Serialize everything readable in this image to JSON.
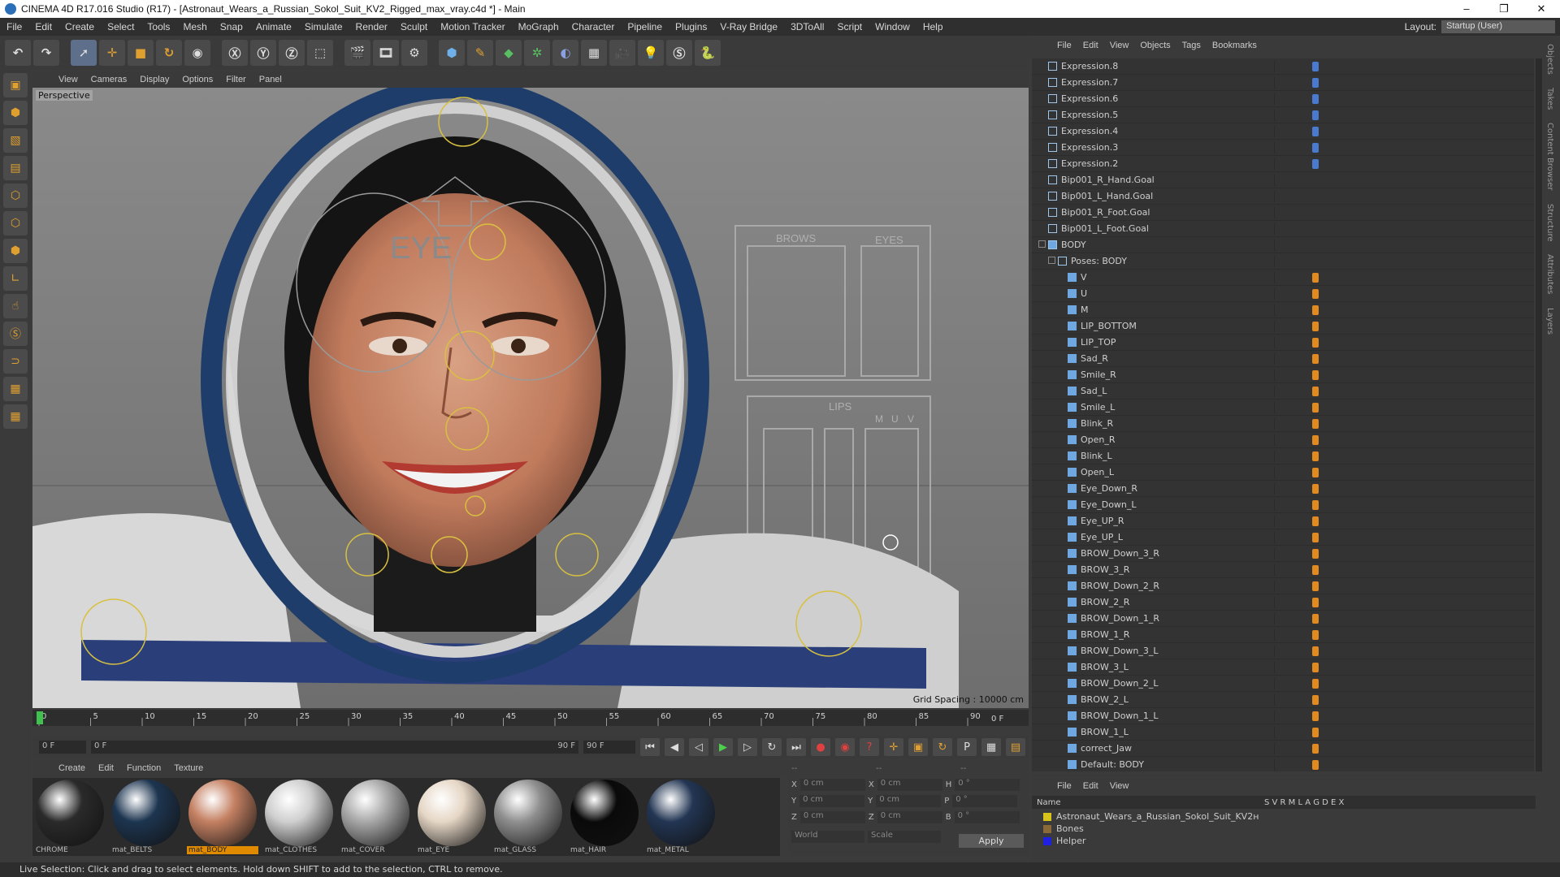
{
  "window": {
    "title": "CINEMA 4D R17.016 Studio (R17) - [Astronaut_Wears_a_Russian_Sokol_Suit_KV2_Rigged_max_vray.c4d *] - Main",
    "controls": [
      "–",
      "❐",
      "✕"
    ]
  },
  "menu": {
    "items": [
      "File",
      "Edit",
      "Create",
      "Select",
      "Tools",
      "Mesh",
      "Snap",
      "Animate",
      "Simulate",
      "Render",
      "Sculpt",
      "Motion Tracker",
      "MoGraph",
      "Character",
      "Pipeline",
      "Plugins",
      "V-Ray Bridge",
      "3DToAll",
      "Script",
      "Window",
      "Help"
    ],
    "layout_label": "Layout:",
    "layout_value": "Startup (User)"
  },
  "viewport": {
    "menu": [
      "View",
      "Cameras",
      "Display",
      "Options",
      "Filter",
      "Panel"
    ],
    "label": "Perspective",
    "grid_spacing": "Grid Spacing : 10000 cm",
    "board": {
      "brows": "BROWS",
      "eyes": "EYES",
      "lips": "LIPS",
      "m": "M",
      "u": "U",
      "v": "V",
      "eye": "EYE"
    }
  },
  "timeline": {
    "ticks": [
      "0",
      "5",
      "10",
      "15",
      "20",
      "25",
      "30",
      "35",
      "40",
      "45",
      "50",
      "55",
      "60",
      "65",
      "70",
      "75",
      "80",
      "85",
      "90"
    ],
    "frame_end": "0 F",
    "start": "0 F",
    "range_start": "0 F",
    "range_end": "90 F",
    "end": "90 F"
  },
  "materials": {
    "menu": [
      "Create",
      "Edit",
      "Function",
      "Texture"
    ],
    "items": [
      {
        "name": "CHROME",
        "color": "#2a2a2a"
      },
      {
        "name": "mat_BELTS",
        "color": "#1d3550"
      },
      {
        "name": "mat_BODY",
        "color": "#c48062"
      },
      {
        "name": "mat_CLOTHES",
        "color": "#cfcfcf"
      },
      {
        "name": "mat_COVER",
        "color": "#a8a8a8"
      },
      {
        "name": "mat_EYE",
        "color": "#e6d7c6"
      },
      {
        "name": "mat_GLASS",
        "color": "#8f8f8f"
      },
      {
        "name": "mat_HAIR",
        "color": "#0a0a0a"
      },
      {
        "name": "mat_METAL",
        "color": "#223553"
      }
    ]
  },
  "coords": {
    "header": [
      "--",
      "--",
      "--"
    ],
    "rows": [
      {
        "a": "X",
        "av": "0 cm",
        "b": "X",
        "bv": "0 cm",
        "c": "H",
        "cv": "0 °"
      },
      {
        "a": "Y",
        "av": "0 cm",
        "b": "Y",
        "bv": "0 cm",
        "c": "P",
        "cv": "0 °"
      },
      {
        "a": "Z",
        "av": "0 cm",
        "b": "Z",
        "bv": "0 cm",
        "c": "B",
        "cv": "0 °"
      }
    ],
    "world": "World",
    "scale": "Scale",
    "apply": "Apply"
  },
  "object_manager": {
    "menu": [
      "File",
      "Edit",
      "View",
      "Objects",
      "Tags",
      "Bookmarks"
    ],
    "objects": [
      {
        "name": "Expression.8",
        "level": 0
      },
      {
        "name": "Expression.7",
        "level": 0
      },
      {
        "name": "Expression.6",
        "level": 0
      },
      {
        "name": "Expression.5",
        "level": 0
      },
      {
        "name": "Expression.4",
        "level": 0
      },
      {
        "name": "Expression.3",
        "level": 0
      },
      {
        "name": "Expression.2",
        "level": 0
      },
      {
        "name": "Bip001_R_Hand.Goal",
        "level": 0
      },
      {
        "name": "Bip001_L_Hand.Goal",
        "level": 0
      },
      {
        "name": "Bip001_R_Foot.Goal",
        "level": 0
      },
      {
        "name": "Bip001_L_Foot.Goal",
        "level": 0
      },
      {
        "name": "BODY",
        "level": 0
      },
      {
        "name": "Poses: BODY",
        "level": 1
      },
      {
        "name": "V",
        "level": 2
      },
      {
        "name": "U",
        "level": 2
      },
      {
        "name": "M",
        "level": 2
      },
      {
        "name": "LIP_BOTTOM",
        "level": 2
      },
      {
        "name": "LIP_TOP",
        "level": 2
      },
      {
        "name": "Sad_R",
        "level": 2
      },
      {
        "name": "Smile_R",
        "level": 2
      },
      {
        "name": "Sad_L",
        "level": 2
      },
      {
        "name": "Smile_L",
        "level": 2
      },
      {
        "name": "Blink_R",
        "level": 2
      },
      {
        "name": "Open_R",
        "level": 2
      },
      {
        "name": "Blink_L",
        "level": 2
      },
      {
        "name": "Open_L",
        "level": 2
      },
      {
        "name": "Eye_Down_R",
        "level": 2
      },
      {
        "name": "Eye_Down_L",
        "level": 2
      },
      {
        "name": "Eye_UP_R",
        "level": 2
      },
      {
        "name": "Eye_UP_L",
        "level": 2
      },
      {
        "name": "BROW_Down_3_R",
        "level": 2
      },
      {
        "name": "BROW_3_R",
        "level": 2
      },
      {
        "name": "BROW_Down_2_R",
        "level": 2
      },
      {
        "name": "BROW_2_R",
        "level": 2
      },
      {
        "name": "BROW_Down_1_R",
        "level": 2
      },
      {
        "name": "BROW_1_R",
        "level": 2
      },
      {
        "name": "BROW_Down_3_L",
        "level": 2
      },
      {
        "name": "BROW_3_L",
        "level": 2
      },
      {
        "name": "BROW_Down_2_L",
        "level": 2
      },
      {
        "name": "BROW_2_L",
        "level": 2
      },
      {
        "name": "BROW_Down_1_L",
        "level": 2
      },
      {
        "name": "BROW_1_L",
        "level": 2
      },
      {
        "name": "correct_Jaw",
        "level": 2
      },
      {
        "name": "Default: BODY",
        "level": 2
      }
    ]
  },
  "layer_manager": {
    "menu": [
      "File",
      "Edit",
      "View"
    ],
    "columns": {
      "name": "Name",
      "flags": "S V R M L A G D E X"
    },
    "layers": [
      {
        "name": "Astronaut_Wears_a_Russian_Sokol_Suit_KV2н",
        "color": "#d8c21c"
      },
      {
        "name": "Bones",
        "color": "#8a6a38"
      },
      {
        "name": "Helper",
        "color": "#2020e0"
      }
    ]
  },
  "right_tabs": [
    "Objects",
    "Takes",
    "Content Browser",
    "Structure",
    "Attributes",
    "Layers"
  ],
  "status": "Live Selection: Click and drag to select elements. Hold down SHIFT to add to the selection, CTRL to remove."
}
